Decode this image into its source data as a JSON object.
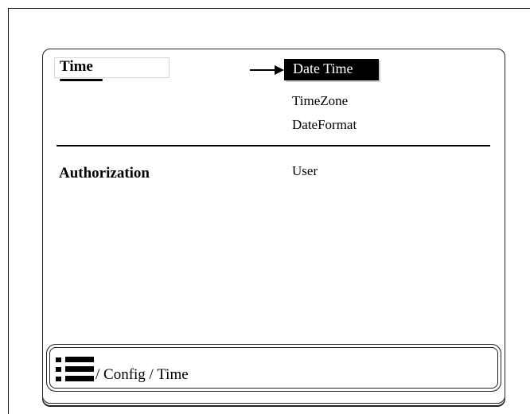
{
  "time_section": {
    "label": "Time",
    "items": [
      "Date Time",
      "TimeZone",
      "DateFormat"
    ],
    "selected_index": 0
  },
  "authorization_section": {
    "label": "Authorization",
    "items": [
      "User"
    ]
  },
  "breadcrumb": {
    "text": "/ Config / Time"
  },
  "icons": {
    "menu": "list-menu-icon",
    "selector": "right-arrow-icon"
  },
  "colors": {
    "selected_bg": "#000000",
    "selected_fg": "#ffffff"
  }
}
